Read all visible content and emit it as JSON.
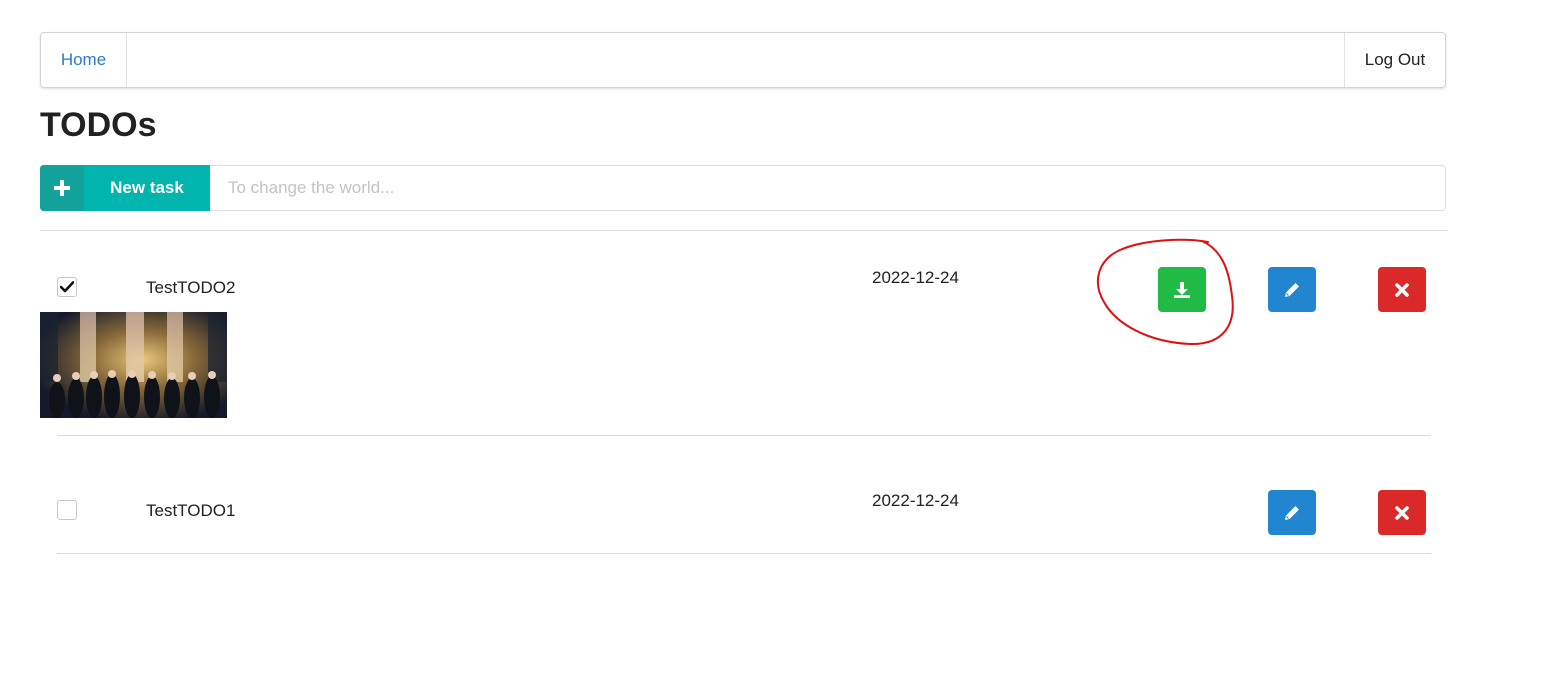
{
  "nav": {
    "home_label": "Home",
    "logout_label": "Log Out"
  },
  "page": {
    "title": "TODOs"
  },
  "new_task": {
    "button_label": "New task",
    "input_placeholder": "To change the world...",
    "input_value": ""
  },
  "todos": [
    {
      "title": "TestTODO2",
      "date": "2022-12-24",
      "checked": true,
      "has_attachment": true,
      "actions": [
        "download-icon",
        "pencil-icon",
        "close-icon"
      ]
    },
    {
      "title": "TestTODO1",
      "date": "2022-12-24",
      "checked": false,
      "has_attachment": false,
      "actions": [
        "pencil-icon",
        "close-icon"
      ]
    }
  ],
  "colors": {
    "teal": "#00b5ad",
    "green": "#21ba45",
    "blue": "#2185d0",
    "red": "#db2828",
    "link": "#2d7bc4",
    "annotation": "#e01010"
  }
}
